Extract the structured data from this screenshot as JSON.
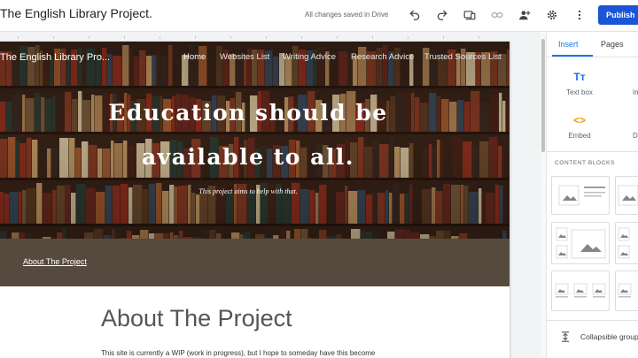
{
  "topbar": {
    "doc_title": "The English Library Project.",
    "save_status": "All changes saved in Drive",
    "publish_label": "Publish",
    "icons": [
      "undo-icon",
      "redo-icon",
      "preview-icon",
      "link-icon",
      "share-icon",
      "settings-icon",
      "more-icon"
    ]
  },
  "site": {
    "title": "The English Library Pro...",
    "nav": [
      "Home",
      "Websites List",
      "Writing Advice",
      "Research Advice",
      "Trusted Sources List"
    ],
    "headline_line1": "Education should be",
    "headline_line2": "available to all.",
    "subline": "This project aims to help with that.",
    "band_link": "About The Project",
    "about_title": "About The Project",
    "about_text": "This site is currently a WIP (work in progress), but I hope to someday have this become"
  },
  "panel": {
    "tabs": [
      "Insert",
      "Pages"
    ],
    "active_tab": "Insert",
    "tools": [
      {
        "label": "Text box",
        "glyph": "Tт",
        "icon": "text-box-icon"
      },
      {
        "label": "Im",
        "glyph": "▢",
        "icon": "image-icon"
      },
      {
        "label": "Embed",
        "glyph": "<>",
        "icon": "embed-icon"
      },
      {
        "label": "D",
        "glyph": "▣",
        "icon": "drive-icon"
      }
    ],
    "content_blocks_heading": "CONTENT BLOCKS",
    "collapsible_label": "Collapsible group"
  },
  "colors": {
    "accent": "#1a73e8",
    "publish": "#1a55d5",
    "band": "#564a3f"
  }
}
